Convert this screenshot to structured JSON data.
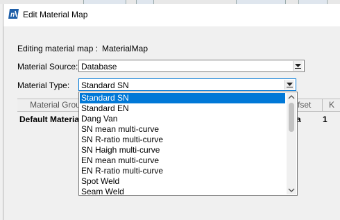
{
  "window": {
    "title": "Edit Material Map"
  },
  "editing": {
    "label": "Editing material map :",
    "value": "MaterialMap"
  },
  "material_source": {
    "label": "Material Source:",
    "value": "Database"
  },
  "material_type": {
    "label": "Material Type:",
    "value": "Standard SN",
    "options": [
      "Standard SN",
      "Standard EN",
      "Dang Van",
      "SN mean multi-curve",
      "SN R-ratio multi-curve",
      "SN Haigh multi-curve",
      "EN mean multi-curve",
      "EN R-ratio multi-curve",
      "Spot Weld",
      "Seam Weld"
    ],
    "selected_index": 0
  },
  "grid": {
    "headers": [
      "Material Grou",
      "fset",
      "K"
    ],
    "row": {
      "material": "Default Materia",
      "offset_tail": "a",
      "k": "1"
    }
  },
  "colors": {
    "selection": "#0078d7",
    "app_icon": "#1f5fa8"
  }
}
